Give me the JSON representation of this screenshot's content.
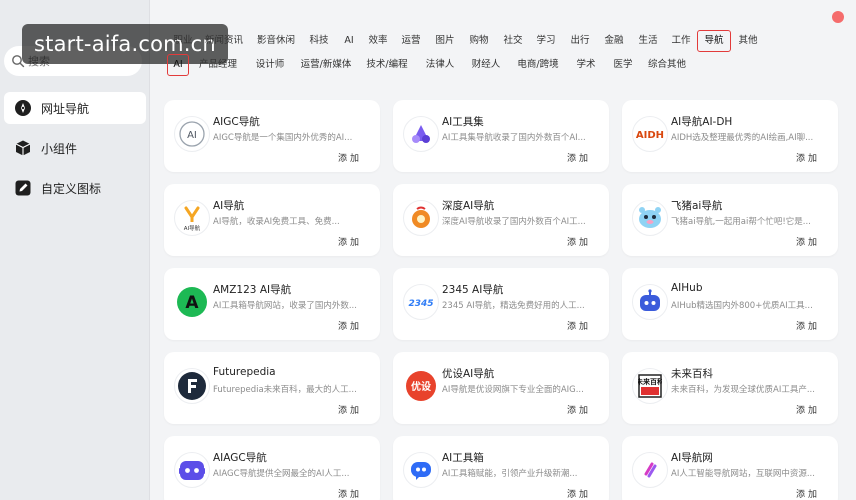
{
  "watermark": "start-aifa.com.cn",
  "sidebar": {
    "search_placeholder": "搜索",
    "items": [
      {
        "label": "网址导航",
        "icon": "compass-icon",
        "active": true
      },
      {
        "label": "小组件",
        "icon": "cube-icon",
        "active": false
      },
      {
        "label": "自定义图标",
        "icon": "edit-icon",
        "active": false
      }
    ]
  },
  "tabs": {
    "row1": [
      "职业",
      "新闻资讯",
      "影音休闲",
      "科技",
      "AI",
      "效率",
      "运营",
      "图片",
      "购物",
      "社交",
      "学习",
      "出行",
      "金融",
      "生活",
      "工作",
      "导航",
      "其他"
    ],
    "row2": [
      "AI",
      "产品经理",
      "设计师",
      "运营/新媒体",
      "技术/编程",
      "法律人",
      "财经人",
      "电商/跨境",
      "学术",
      "医学",
      "综合其他"
    ],
    "selected_row1": "导航",
    "selected_row2": "AI"
  },
  "cards": [
    {
      "title": "AIGC导航",
      "desc": "AIGC导航是一个集国内外优秀的AI...",
      "add": "添加",
      "logo": "aigc-logo"
    },
    {
      "title": "AI工具集",
      "desc": "AI工具集导航收录了国内外数百个AI...",
      "add": "添加",
      "logo": "ai-tools-logo"
    },
    {
      "title": "AI导航AI-DH",
      "desc": "AIDH选及整理最优秀的AI绘画,AI聊...",
      "add": "添加",
      "logo": "aidh-logo"
    },
    {
      "title": "AI导航",
      "desc": "AI导航，收录AI免费工具、免费...",
      "add": "添加",
      "logo": "ai-nav-logo"
    },
    {
      "title": "深度AI导航",
      "desc": "深度AI导航收录了国内外数百个AI工...",
      "add": "添加",
      "logo": "deep-ai-logo"
    },
    {
      "title": "飞猪ai导航",
      "desc": "飞猪ai导航,一起用ai帮个忙吧!它是...",
      "add": "添加",
      "logo": "feizhu-logo"
    },
    {
      "title": "AMZ123 AI导航",
      "desc": "AI工具箱导航网站，收录了国内外数...",
      "add": "添加",
      "logo": "amz123-logo"
    },
    {
      "title": "2345 AI导航",
      "desc": "2345 AI导航，精选免费好用的人工...",
      "add": "添加",
      "logo": "2345-logo"
    },
    {
      "title": "AIHub",
      "desc": "AIHub精选国内外800+优质AI工具...",
      "add": "添加",
      "logo": "aihub-logo"
    },
    {
      "title": "Futurepedia",
      "desc": "Futurepedia未来百科，最大的人工...",
      "add": "添加",
      "logo": "futurepedia-logo"
    },
    {
      "title": "优设AI导航",
      "desc": "AI导航是优设网旗下专业全面的AIG...",
      "add": "添加",
      "logo": "youshe-logo"
    },
    {
      "title": "未来百科",
      "desc": "未来百科，为发现全球优质AI工具产...",
      "add": "添加",
      "logo": "weilai-logo"
    },
    {
      "title": "AIAGC导航",
      "desc": "AIAGC导航提供全网最全的AI人工...",
      "add": "添加",
      "logo": "aiagc-logo"
    },
    {
      "title": "AI工具箱",
      "desc": "AI工具箱赋能，引领产业升级新潮...",
      "add": "添加",
      "logo": "ai-toolbox-logo"
    },
    {
      "title": "AI导航网",
      "desc": "AI人工智能导航网站，互联网中资源...",
      "add": "添加",
      "logo": "ai-nav-net-logo"
    }
  ],
  "logos": {
    "aigc": "AI",
    "aidh": "AIDH",
    "ainav": "AI导航",
    "amz": "A",
    "n2345": "2345",
    "youshe": "优设",
    "weilai": "未来百科"
  },
  "colors": {
    "accent_red": "#e23b3b",
    "close_dot": "#f56c6c"
  }
}
